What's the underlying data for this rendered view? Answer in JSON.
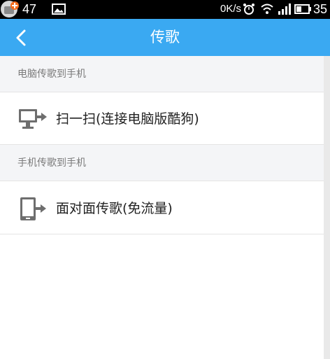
{
  "status_bar": {
    "time_partial": "47",
    "net_speed": "0K/s",
    "battery_level": "35",
    "icons": [
      "app-logo-icon",
      "image-icon",
      "alarm-icon",
      "wifi-icon",
      "signal-icon",
      "battery-icon"
    ]
  },
  "header": {
    "title": "传歌",
    "back_icon": "chevron-left-icon",
    "background_color": "#3aa9f2"
  },
  "sections": [
    {
      "header": "电脑传歌到手机",
      "items": [
        {
          "label": "扫一扫(连接电脑版酷狗)",
          "icon": "computer-transfer-icon"
        }
      ]
    },
    {
      "header": "手机传歌到手机",
      "items": [
        {
          "label": "面对面传歌(免流量)",
          "icon": "phone-transfer-icon"
        }
      ]
    }
  ]
}
